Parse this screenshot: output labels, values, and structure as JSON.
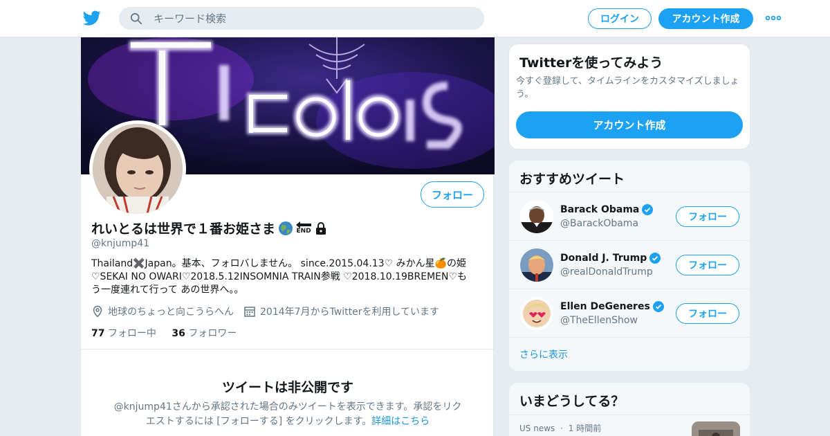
{
  "header": {
    "search_placeholder": "キーワード検索",
    "login_label": "ログイン",
    "signup_label": "アカウント作成"
  },
  "profile": {
    "display_name": "れいとるは世界で１番お姫さま",
    "name_emoji_text": "END",
    "handle": "@knjump41",
    "follow_label": "フォロー",
    "bio_lines": [
      "Thailand✖️Japan。基本、フォロバしません。 since.2015.04.13♡ みかん星🍊の姫",
      "♡SEKAI NO OWARI♡2018.5.12INSOMNIA TRAIN参戦 ♡2018.10.19BREMEN♡も",
      "う一度連れて行って あの世界へ。。"
    ],
    "location": "地球のちょっと向こうらへん",
    "joined": "2014年7月からTwitterを利用しています",
    "following_count": "77",
    "following_label": "フォロー中",
    "followers_count": "36",
    "followers_label": "フォロワー",
    "protected_title": "ツイートは非公開です",
    "protected_desc_line1": "@knjump41さんから承認された場合のみツイートを表示できます。承認をリク",
    "protected_desc_line2": "エストするには [フォローする] をクリックします。",
    "protected_link": "詳細はこちら"
  },
  "signup_card": {
    "title": "Twitterを使ってみよう",
    "desc_line1": "今すぐ登録して、タイムラインをカスタマイズしましょ",
    "desc_line2": "う。",
    "button_label": "アカウント作成"
  },
  "reco_card": {
    "title": "おすすめツイート",
    "users": [
      {
        "name": "Barack Obama",
        "handle": "@BarackObama",
        "follow_label": "フォロー"
      },
      {
        "name": "Donald J. Trump",
        "handle": "@realDonaldTrump",
        "follow_label": "フォロー"
      },
      {
        "name": "Ellen DeGeneres",
        "handle": "@TheEllenShow",
        "follow_label": "フォロー"
      }
    ],
    "more_label": "さらに表示"
  },
  "trends_card": {
    "title": "いまどうしてる？",
    "item_source": "US news",
    "item_time": "1 時間前"
  },
  "colors": {
    "accent": "#1da1f2",
    "link": "#1b95e0",
    "muted": "#657786",
    "page_bg": "#e6ecf0"
  }
}
